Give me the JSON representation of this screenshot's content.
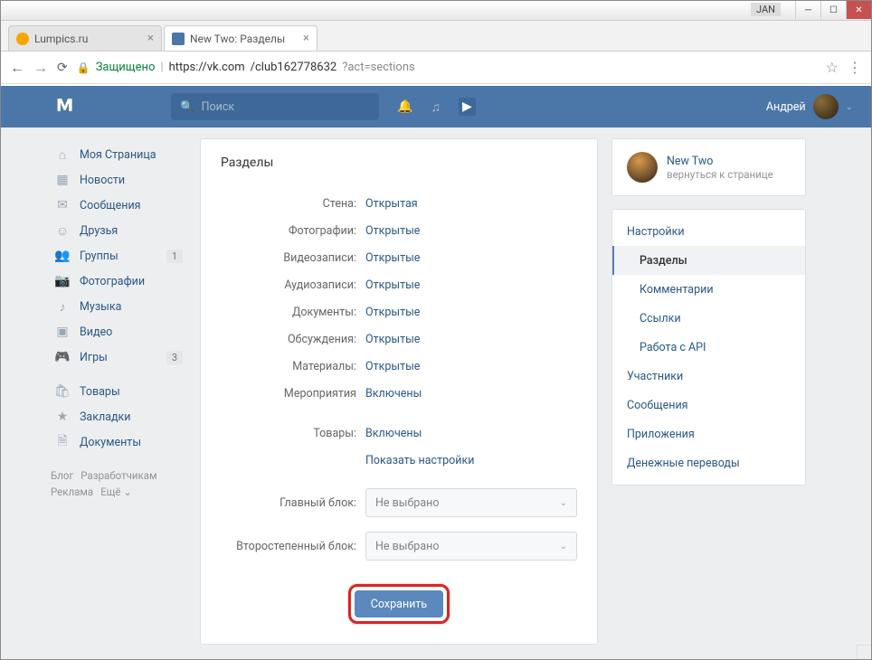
{
  "window": {
    "user_tag": "JAN"
  },
  "tabs": [
    {
      "title": "Lumpics.ru"
    },
    {
      "title": "New Two: Разделы"
    }
  ],
  "address": {
    "secure_label": "Защищено",
    "host": "https://vk.com",
    "path": "/club162778632",
    "query": "?act=sections"
  },
  "header": {
    "search_placeholder": "Поиск",
    "username": "Андрей"
  },
  "sidebar": {
    "items": [
      {
        "label": "Моя Страница"
      },
      {
        "label": "Новости"
      },
      {
        "label": "Сообщения"
      },
      {
        "label": "Друзья"
      },
      {
        "label": "Группы",
        "badge": "1"
      },
      {
        "label": "Фотографии"
      },
      {
        "label": "Музыка"
      },
      {
        "label": "Видео"
      },
      {
        "label": "Игры",
        "badge": "3"
      }
    ],
    "extra": [
      {
        "label": "Товары"
      },
      {
        "label": "Закладки"
      },
      {
        "label": "Документы"
      }
    ],
    "footer": {
      "blog": "Блог",
      "dev": "Разработчикам",
      "ads": "Реклама",
      "more": "Ещё ⌄"
    }
  },
  "main": {
    "title": "Разделы",
    "rows": [
      {
        "label": "Стена:",
        "value": "Открытая"
      },
      {
        "label": "Фотографии:",
        "value": "Открытые"
      },
      {
        "label": "Видеозаписи:",
        "value": "Открытые"
      },
      {
        "label": "Аудиозаписи:",
        "value": "Открытые"
      },
      {
        "label": "Документы:",
        "value": "Открытые"
      },
      {
        "label": "Обсуждения:",
        "value": "Открытые"
      },
      {
        "label": "Материалы:",
        "value": "Открытые"
      },
      {
        "label": "Мероприятия",
        "value": "Включены"
      }
    ],
    "products_label": "Товары:",
    "products_value": "Включены",
    "show_settings": "Показать настройки",
    "primary_block_label": "Главный блок:",
    "secondary_block_label": "Второстепенный блок:",
    "not_selected": "Не выбрано",
    "save": "Сохранить"
  },
  "right": {
    "group_name": "New Two",
    "group_sub": "вернуться к странице",
    "nav": {
      "settings": "Настройки",
      "sections": "Разделы",
      "comments": "Комментарии",
      "links": "Ссылки",
      "api": "Работа с API",
      "members": "Участники",
      "messages": "Сообщения",
      "apps": "Приложения",
      "payments": "Денежные переводы"
    }
  }
}
